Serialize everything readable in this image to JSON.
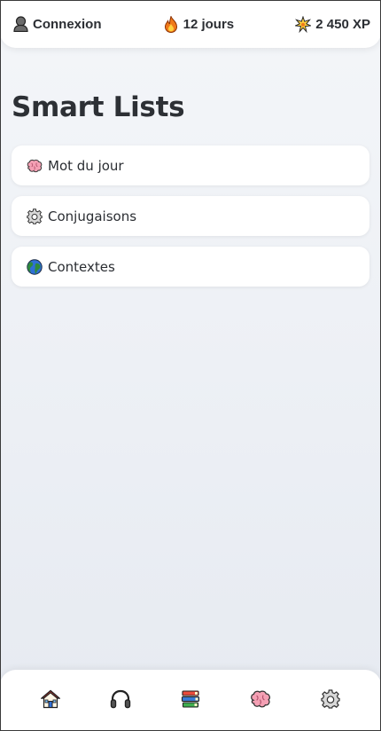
{
  "header": {
    "login_label": "Connexion",
    "login_icon": "user-icon",
    "streak_label": "12 jours",
    "streak_icon": "flame-icon",
    "xp_label": "2 450 XP",
    "xp_icon": "sparkle-icon"
  },
  "page": {
    "title": "Smart Lists"
  },
  "lists": [
    {
      "label": "Mot du jour",
      "icon": "brain-icon"
    },
    {
      "label": "Conjugaisons",
      "icon": "gear-icon"
    },
    {
      "label": "Contextes",
      "icon": "globe-icon"
    }
  ],
  "bottom_nav": [
    {
      "icon": "home-icon"
    },
    {
      "icon": "headphones-icon"
    },
    {
      "icon": "books-icon"
    },
    {
      "icon": "brain-icon"
    },
    {
      "icon": "gear-icon"
    }
  ],
  "colors": {
    "brain": "#f4a0b4",
    "flame": "#f07a1a",
    "globe": "#2f8a3c",
    "books": "#3a7bd5"
  }
}
